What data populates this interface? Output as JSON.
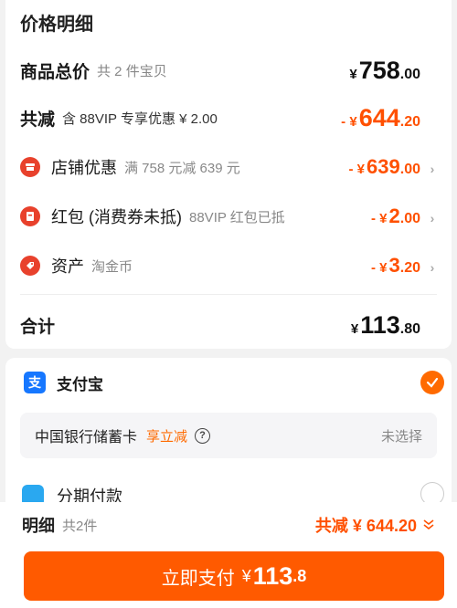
{
  "section_title": "价格明细",
  "goods_total": {
    "label": "商品总价",
    "sub": "共 2 件宝贝",
    "yen": "¥",
    "int": "758",
    "dec": ".00"
  },
  "total_reduce": {
    "label": "共减",
    "sub": "含 88VIP 专享优惠 ¥ 2.00",
    "prefix": "- ¥",
    "int": "644",
    "dec": ".20"
  },
  "discounts": [
    {
      "label": "店铺优惠",
      "sub": "满 758 元减 639 元",
      "prefix": "- ¥",
      "int": "639",
      "dec": ".00",
      "icon": "store-icon"
    },
    {
      "label": "红包 (消费券未抵)",
      "sub": "88VIP 红包已抵",
      "prefix": "- ¥",
      "int": "2",
      "dec": ".00",
      "icon": "red-packet-icon"
    },
    {
      "label": "资产",
      "sub": "淘金币",
      "prefix": "- ¥",
      "int": "3",
      "dec": ".20",
      "icon": "tag-icon"
    }
  ],
  "subtotal": {
    "label": "合计",
    "yen": "¥",
    "int": "113",
    "dec": ".80"
  },
  "payment": {
    "alipay_label": "支付宝",
    "alipay_icon_text": "支",
    "bank_name": "中国银行储蓄卡",
    "bank_promo": "享立减",
    "bank_status": "未选择",
    "partial_label": "分期付款"
  },
  "bottom": {
    "title": "明细",
    "count": "共2件",
    "total_text": "共减 ¥ 644.20",
    "pay_label": "立即支付",
    "pay_yen": "¥",
    "pay_int": "113",
    "pay_dec": ".8"
  },
  "colors": {
    "accent": "#ff5000",
    "button": "#ff5a00",
    "alipay": "#1677ff",
    "icon_red": "#e8412c"
  }
}
